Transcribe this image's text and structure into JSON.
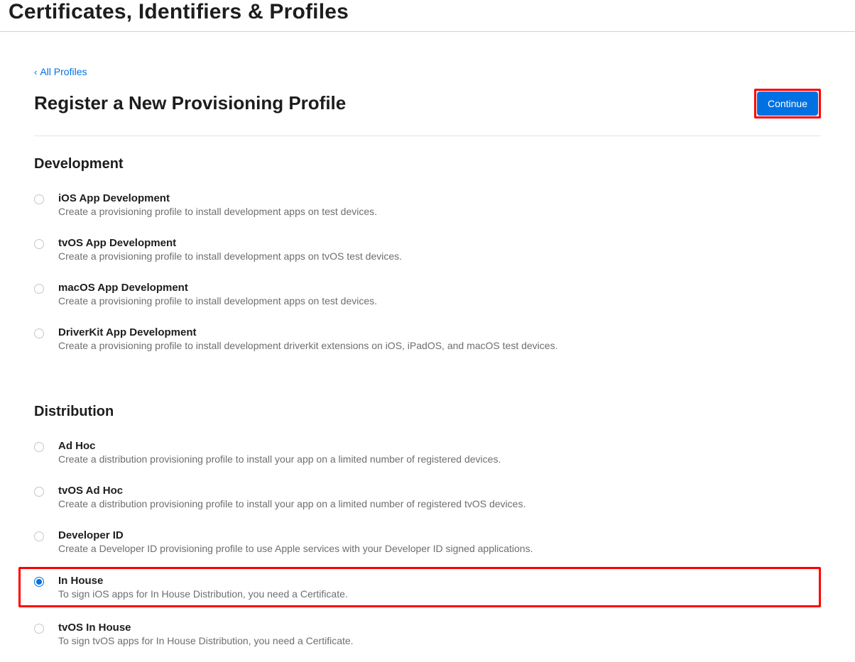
{
  "header": {
    "title": "Certificates, Identifiers & Profiles"
  },
  "back_link": {
    "label": "All Profiles"
  },
  "page": {
    "title": "Register a New Provisioning Profile",
    "continue_label": "Continue"
  },
  "sections": {
    "development": {
      "heading": "Development",
      "options": [
        {
          "title": "iOS App Development",
          "desc": "Create a provisioning profile to install development apps on test devices.",
          "selected": false
        },
        {
          "title": "tvOS App Development",
          "desc": "Create a provisioning profile to install development apps on tvOS test devices.",
          "selected": false
        },
        {
          "title": "macOS App Development",
          "desc": "Create a provisioning profile to install development apps on test devices.",
          "selected": false
        },
        {
          "title": "DriverKit App Development",
          "desc": "Create a provisioning profile to install development driverkit extensions on iOS, iPadOS, and macOS test devices.",
          "selected": false
        }
      ]
    },
    "distribution": {
      "heading": "Distribution",
      "options": [
        {
          "title": "Ad Hoc",
          "desc": "Create a distribution provisioning profile to install your app on a limited number of registered devices.",
          "selected": false
        },
        {
          "title": "tvOS Ad Hoc",
          "desc": "Create a distribution provisioning profile to install your app on a limited number of registered tvOS devices.",
          "selected": false
        },
        {
          "title": "Developer ID",
          "desc": "Create a Developer ID provisioning profile to use Apple services with your Developer ID signed applications.",
          "selected": false
        },
        {
          "title": "In House",
          "desc": "To sign iOS apps for In House Distribution, you need a Certificate.",
          "selected": true,
          "highlighted": true
        },
        {
          "title": "tvOS In House",
          "desc": "To sign tvOS apps for In House Distribution, you need a Certificate.",
          "selected": false
        }
      ]
    }
  }
}
